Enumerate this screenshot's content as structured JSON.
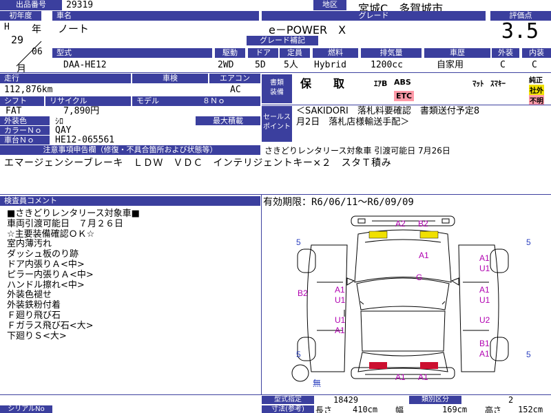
{
  "header": {
    "lot_label": "出品番号",
    "lot_number": "29319",
    "region_label": "地区",
    "region_value": "宮城C　多賀城市"
  },
  "row1": {
    "year_label": "初年度",
    "model_name_label": "車名",
    "grade_label": "グレード",
    "score_label": "評価点",
    "era": "H",
    "year_kanji": "年",
    "year_value": "29",
    "month_value": "06",
    "month_kanji": "月",
    "model_name": "ノート",
    "grade": "e－POWER　X",
    "grade_sub_label": "グレード補記",
    "score": "3.5"
  },
  "row2": {
    "type_label": "型式",
    "drive_label": "駆動",
    "door_label": "ドア",
    "capacity_label": "定員",
    "fuel_label": "燃料",
    "displacement_label": "排気量",
    "history_label": "車歴",
    "exterior_label": "外装",
    "interior_label": "内装",
    "type_value": "DAA-HE12",
    "drive_value": "2WD",
    "door_value": "5D",
    "capacity_value": "5人",
    "fuel_value": "Hybrid",
    "displacement_value": "1200cc",
    "history_value": "自家用",
    "exterior_value": "C",
    "interior_value": "C"
  },
  "row3": {
    "mileage_label": "走行",
    "inspection_label": "車検",
    "ac_label": "エアコン",
    "mileage_value": "112,876km",
    "ac_value": "AC",
    "shift_label": "シフト",
    "recycle_label": "リサイクル",
    "model_label": "モデル",
    "model_value": "８Ｎｏ",
    "shift_value": "FAT",
    "recycle_value": "7,890円",
    "color_label": "外装色",
    "color_value": "ｼﾛ",
    "loadcap_label": "最大積載",
    "color_no_label": "カラーＮｏ",
    "color_no_value": "QAY",
    "chassis_label": "車台Ｎｏ",
    "chassis_value": "HE12-065561"
  },
  "docs": {
    "docs_label_1": "書類",
    "docs_label_2": "装備",
    "keep": "保　　取",
    "ac_mark": "ｴｱB",
    "abs": "ABS",
    "mat": "ﾏｯﾄ",
    "smart": "ｽﾏｷｰ",
    "etc": "ETC",
    "genuine": "純正",
    "aftermarket": "社外",
    "unknown": "不明"
  },
  "sales_point": {
    "label_1": "セールス",
    "label_2": "ポイント",
    "line1": "＜SAKIDORI　落札料要確認　書類送付予定8",
    "line2": "月2日　落札店様輸送手配＞"
  },
  "notice": {
    "label": "注意事項申告欄（修復・不具合箇所および状態等）",
    "right_text": "さきどりレンタリース対象車 引渡可能日 7月26日",
    "equipment": "エマージェンシーブレーキ　ＬＤＷ　ＶＤＣ　インテリジェントキー×２　スタＴ積み"
  },
  "inspector": {
    "label": "検査員コメント",
    "validity": "有効期限：R6/06/11～R6/09/09",
    "lines": [
      "■さきどりレンタリース対象車■",
      "車両引渡可能日　７月２６日",
      "☆主要装備確認ＯＫ☆",
      "室内薄汚れ",
      "ダッシュ板のり跡",
      "ドア内張りＡ<中>",
      "ピラー内張りＡ<中>",
      "ハンドル擦れ<中>",
      "外装色褪せ",
      "外装鉄粉付着",
      "Ｆ廻り飛び石",
      "Ｆガラス飛び石<大>",
      "下廻りＳ<大>"
    ]
  },
  "diagram": {
    "marks": {
      "front_a2": "A2",
      "front_b2": "B2",
      "hood_a1": "A1",
      "roof_g": "G",
      "left_b2": "B2",
      "lf_a1": "A1",
      "lf_u1": "U1",
      "lr_u1": "U1",
      "lr_a1": "A1",
      "rf_a1": "A1",
      "rf_u1": "U1",
      "rm_a1": "A1",
      "rm_u1": "U1",
      "rr_u2": "U2",
      "rb_b1": "B1",
      "rb_a1": "A1",
      "rear_a1a": "A1",
      "rear_a1b": "A1",
      "tire_fl": "5",
      "tire_fr": "5",
      "tire_rl": "5",
      "tire_rr": "5"
    },
    "no_mark": "無"
  },
  "footer": {
    "serial_label": "シリアルNo",
    "type_cert_label": "型式指定",
    "type_cert_value": "18429",
    "class_label": "類別区分",
    "class_value": "2",
    "dims_label": "寸法(参考)",
    "length_label": "長さ",
    "length_value": "410cm",
    "width_label": "幅",
    "width_value": "169cm",
    "height_label": "高さ",
    "height_value": "152cm"
  },
  "colors": {
    "header_bg": "#3b3f9e",
    "damage_text": "#b000b0",
    "front_marker": "#f0e000",
    "rear_marker": "#cc1030",
    "etc_bg": "#ff9aa8",
    "aftermarket_bg": "#f0e000",
    "unknown_bg": "#ff9aa8",
    "tire_num": "#2a3fbf"
  }
}
